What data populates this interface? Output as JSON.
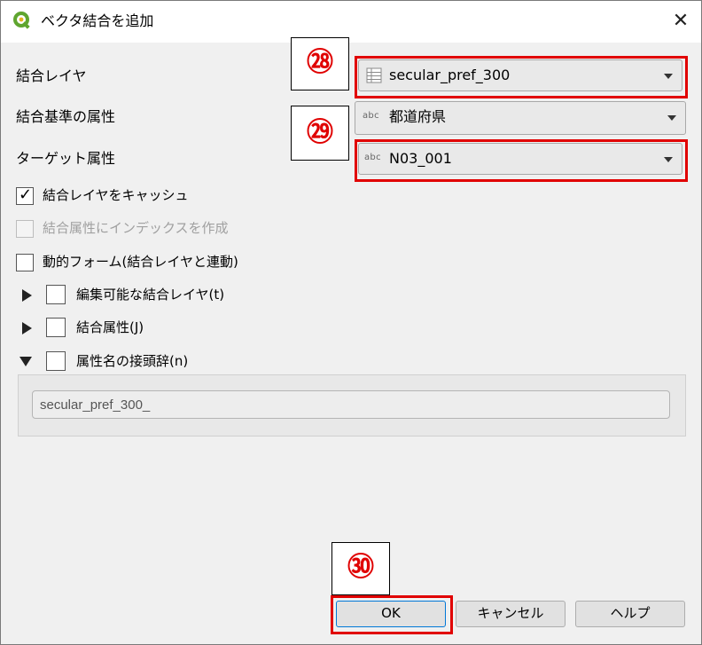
{
  "window": {
    "title": "ベクタ結合を追加",
    "close_glyph": "✕"
  },
  "labels": {
    "join_layer": "結合レイヤ",
    "join_field": "結合基準の属性",
    "target_field": "ターゲット属性"
  },
  "combos": {
    "join_layer": {
      "value": "secular_pref_300",
      "icon": "table-icon"
    },
    "join_field": {
      "value": "都道府県",
      "icon_text": "abc"
    },
    "target_field": {
      "value": "N03_001",
      "icon_text": "abc"
    }
  },
  "checkboxes": {
    "cache": {
      "label": "結合レイヤをキャッシュ",
      "checked": true
    },
    "index": {
      "label": "結合属性にインデックスを作成",
      "enabled": false
    },
    "dynamic_form": {
      "label": "動的フォーム(結合レイヤと連動)"
    },
    "editable": {
      "label": "編集可能な結合レイヤ(t)"
    },
    "joined_fields": {
      "label": "結合属性(J)"
    },
    "prefix": {
      "label": "属性名の接頭辞(n)"
    }
  },
  "prefix_value": "secular_pref_300_",
  "callouts": {
    "c28": "㉘",
    "c29": "㉙",
    "c30": "㉚"
  },
  "buttons": {
    "ok": "OK",
    "cancel": "キャンセル",
    "help": "ヘルプ"
  },
  "colors": {
    "highlight": "#e10000",
    "callout_text": "#e00000",
    "qgis_green": "#5fa52f"
  }
}
